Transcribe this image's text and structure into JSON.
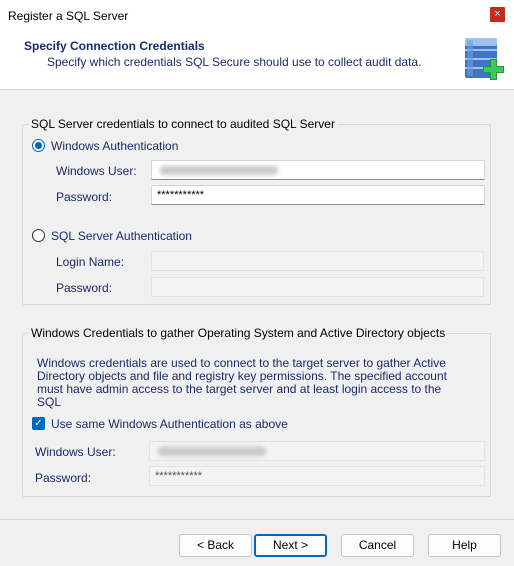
{
  "window": {
    "title": "Register a SQL Server",
    "close_glyph": "×"
  },
  "header": {
    "title": "Specify Connection Credentials",
    "subtitle": "Specify which credentials SQL Secure should use to collect audit data.",
    "icon": "database-add-icon"
  },
  "sql_group": {
    "legend": "SQL Server credentials to connect to audited SQL Server",
    "windows_auth": {
      "label": "Windows Authentication",
      "selected": true
    },
    "windows_user": {
      "label": "Windows User:",
      "value": ""
    },
    "password": {
      "label": "Password:",
      "value": "***********"
    },
    "sql_auth": {
      "label": "SQL Server Authentication",
      "selected": false
    },
    "login_name": {
      "label": "Login Name:",
      "value": ""
    },
    "sql_password": {
      "label": "Password:",
      "value": ""
    }
  },
  "win_group": {
    "legend": "Windows Credentials to gather Operating System and Active Directory objects",
    "info": "Windows credentials are used to connect to the target server to gather Active Directory objects and file and registry key permissions. The specified account must have admin access to the target server and at least login access to the SQL",
    "use_same": {
      "label": "Use same Windows Authentication as above",
      "checked": true
    },
    "windows_user": {
      "label": "Windows User:",
      "value": ""
    },
    "password": {
      "label": "Password:",
      "value": "***********"
    }
  },
  "buttons": {
    "back": "< Back",
    "next": "Next >",
    "cancel": "Cancel",
    "help": "Help"
  },
  "colors": {
    "accent": "#0067c0",
    "label_text": "#1b2a69",
    "close": "#c42b1c"
  }
}
